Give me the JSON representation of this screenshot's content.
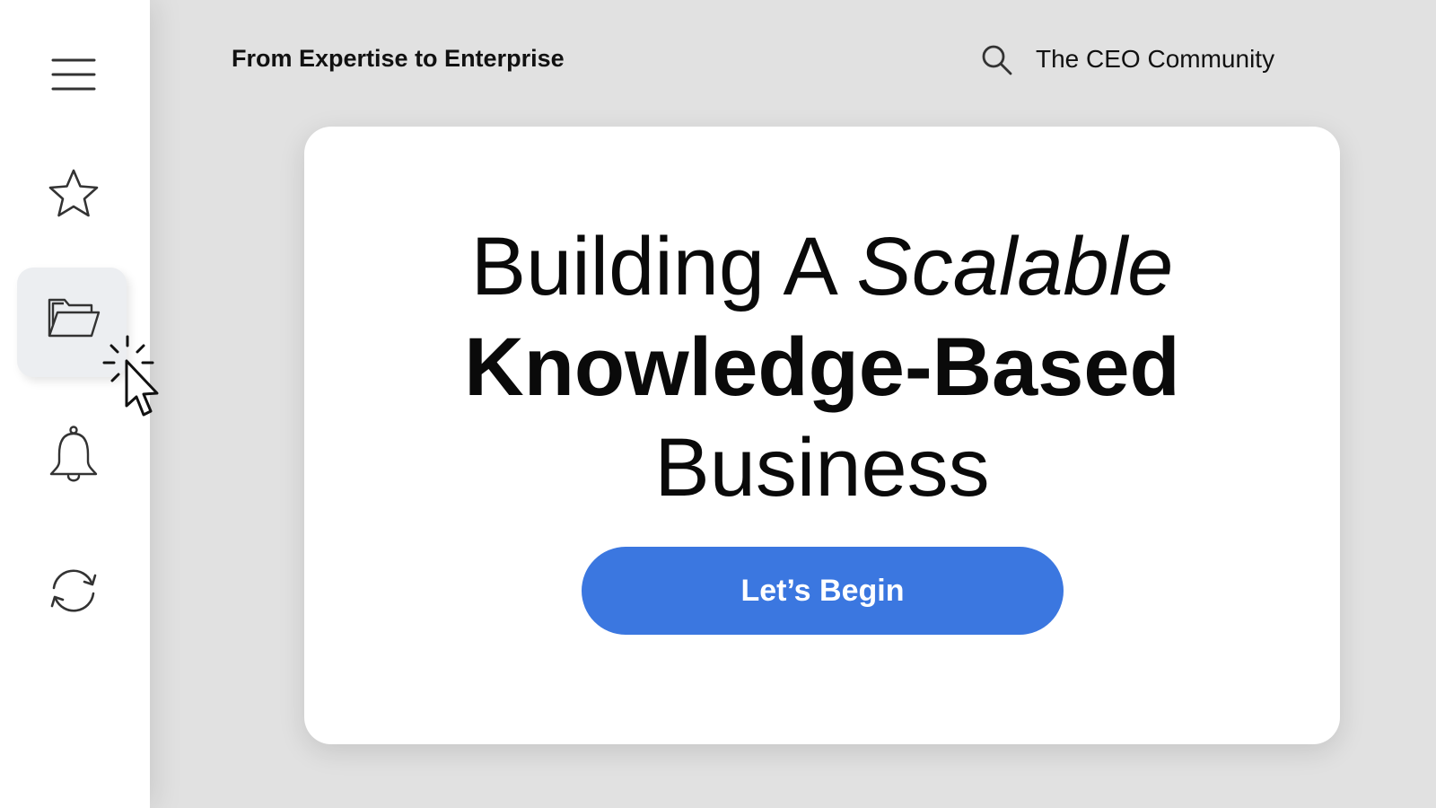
{
  "sidebar": {
    "items": [
      {
        "icon": "hamburger-menu-icon"
      },
      {
        "icon": "star-icon"
      },
      {
        "icon": "folder-open-icon",
        "active": true
      },
      {
        "icon": "bell-icon"
      },
      {
        "icon": "refresh-icon"
      }
    ]
  },
  "header": {
    "tagline": "From Expertise to Enterprise",
    "search_icon": "search-icon",
    "community_label": "The CEO Community"
  },
  "hero": {
    "line1_regular": "Building A ",
    "line1_italic": "Scalable",
    "line2": "Knowledge-Based",
    "line3": "Business",
    "cta_label": "Let’s Begin"
  },
  "colors": {
    "background": "#e1e1e1",
    "sidebar": "#ffffff",
    "active_item": "#eceef1",
    "accent": "#3b77e0"
  }
}
